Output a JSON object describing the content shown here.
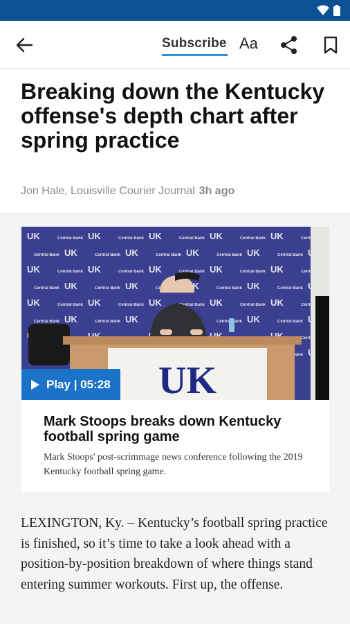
{
  "toolbar": {
    "subscribe_label": "Subscribe",
    "text_size_label": "Aa"
  },
  "article": {
    "headline": "Breaking down the Kentucky offense's depth chart after spring practice",
    "byline": "Jon Hale, Louisville Courier Journal",
    "time_ago": "3h ago",
    "body": "LEXINGTON, Ky. – Kentucky’s football spring practice is finished, so it’s time to take a look ahead with a position-by-position breakdown of where things stand entering summer workouts. First up, the offense."
  },
  "video": {
    "play_label": "Play | 05:28",
    "title": "Mark Stoops breaks down Kentucky football spring game",
    "description": "Mark Stoops' post-scrimmage news conference following the 2019 Kentucky football spring game.",
    "podium_logo": "UK",
    "backdrop_logo": "UK",
    "backdrop_sponsor": "Central Bank"
  },
  "colors": {
    "status_bar": "#0d5195",
    "accent": "#2d8fd6",
    "play_button": "#1a73c9"
  }
}
